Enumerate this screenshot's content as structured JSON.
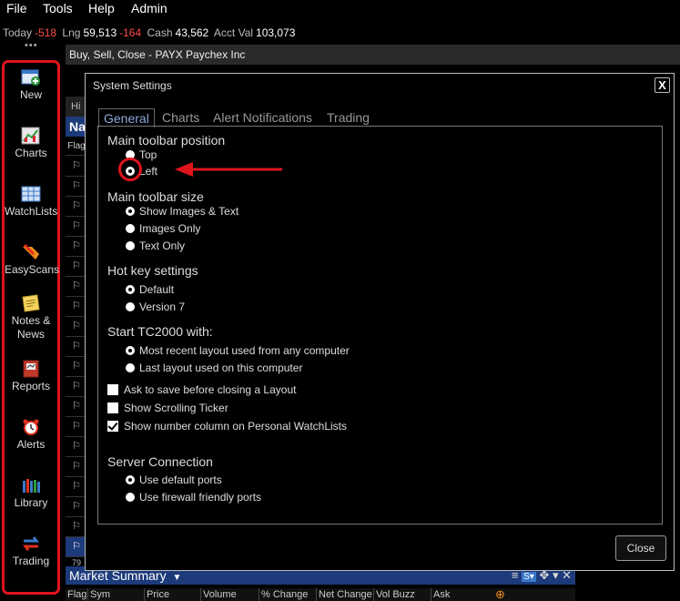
{
  "menu": {
    "file": "File",
    "tools": "Tools",
    "help": "Help",
    "admin": "Admin"
  },
  "account": {
    "today_label": "Today",
    "today_value": "-518",
    "lng_label": "Lng",
    "lng_value": "59,513",
    "lng_change": "-164",
    "cash_label": "Cash",
    "cash_value": "43,562",
    "acct_label": "Acct Val",
    "acct_value": "103,073"
  },
  "toolbar": {
    "items": [
      {
        "label": "New",
        "icon": "new-icon"
      },
      {
        "label": "Charts",
        "icon": "chart-icon"
      },
      {
        "label": "WatchLists",
        "icon": "watchlist-icon"
      },
      {
        "label": "EasyScans",
        "icon": "easyscan-icon"
      },
      {
        "label": "Notes &\nNews",
        "icon": "notes-icon"
      },
      {
        "label": "Reports",
        "icon": "reports-icon"
      },
      {
        "label": "Alerts",
        "icon": "alarm-clock-icon"
      },
      {
        "label": "Library",
        "icon": "library-icon"
      },
      {
        "label": "Trading",
        "icon": "trading-icon"
      }
    ],
    "highlight_color": "#e0141c"
  },
  "background_window": {
    "title": "Buy, Sell, Close - PAYX Paychex Inc",
    "tab_fragment": "Hi",
    "list_header_fragment": "Na",
    "flag_col": "Flag",
    "row_count_fragment": "79",
    "market_summary": {
      "title": "Market Summary",
      "columns": [
        "Flag",
        "Sym",
        "Price",
        "Volume",
        "% Change",
        "Net Change",
        "Vol Buzz",
        "Ask"
      ]
    }
  },
  "dialog": {
    "title": "System Settings",
    "close_x": "X",
    "tabs": [
      "General",
      "Charts",
      "Alert Notifications",
      "Trading"
    ],
    "sections": {
      "toolbar_position": {
        "title": "Main toolbar position",
        "options": [
          "Top",
          "Left"
        ],
        "selected": "Left"
      },
      "toolbar_size": {
        "title": "Main toolbar size",
        "options": [
          "Show Images & Text",
          "Images Only",
          "Text Only"
        ],
        "selected": "Show Images & Text"
      },
      "hot_keys": {
        "title": "Hot key settings",
        "options": [
          "Default",
          "Version 7"
        ],
        "selected": "Default"
      },
      "start_with": {
        "title": "Start TC2000 with:",
        "options": [
          "Most recent layout used from any computer",
          "Last layout used on this computer"
        ],
        "selected": "Most recent layout used from any computer"
      },
      "checkboxes": [
        {
          "label": "Ask to save before closing a Layout",
          "checked": false
        },
        {
          "label": "Show Scrolling Ticker",
          "checked": false
        },
        {
          "label": "Show number column on Personal WatchLists",
          "checked": true
        }
      ],
      "server": {
        "title": "Server Connection",
        "options": [
          "Use default ports",
          "Use firewall friendly ports"
        ],
        "selected": "Use default ports"
      }
    },
    "close_button": "Close"
  },
  "annotation_color": "#e0141c"
}
